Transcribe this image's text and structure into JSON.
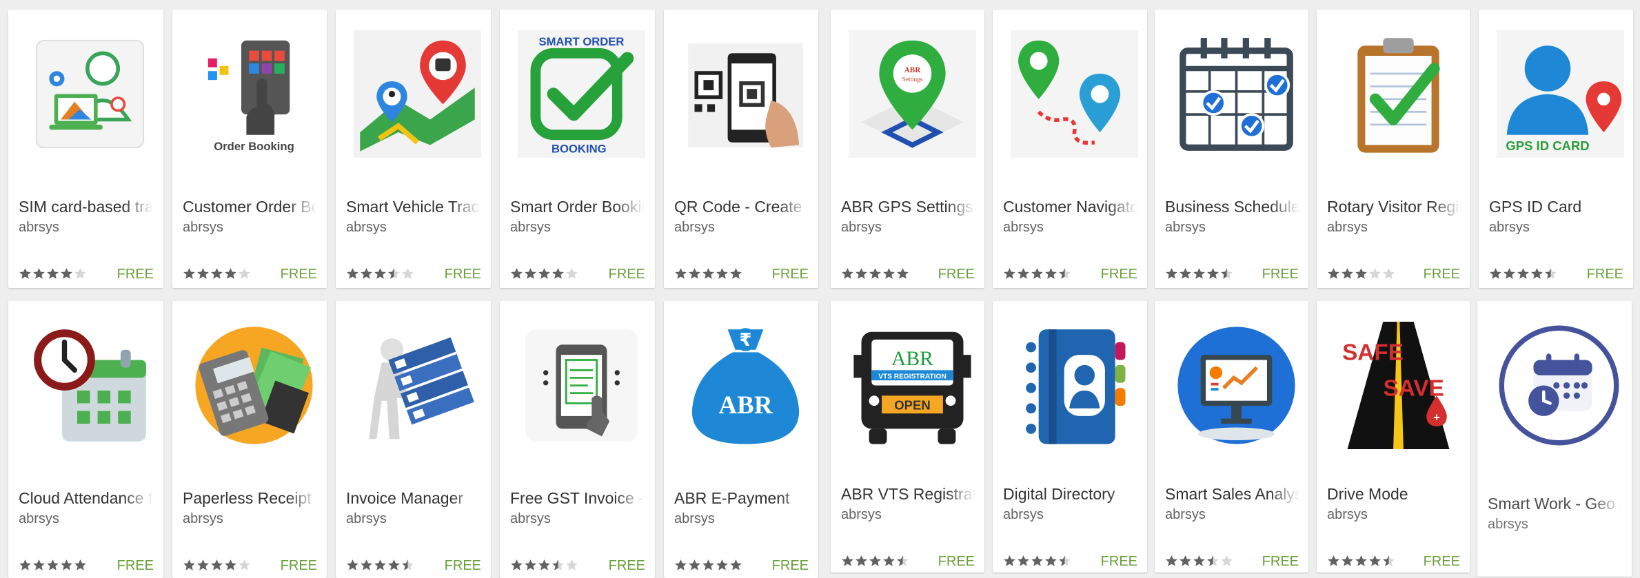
{
  "colors": {
    "free_label": "#689f38",
    "star_filled": "#616161",
    "star_empty": "#d6d6d6",
    "title_text": "#333333",
    "developer_text": "#616161"
  },
  "apps": [
    {
      "title": "SIM card-based tracking",
      "developer": "abrsys",
      "rating": 4.0,
      "price": "FREE",
      "icon": "sim-tracker-icon"
    },
    {
      "title": "Customer Order Booking",
      "developer": "abrsys",
      "rating": 4.0,
      "price": "FREE",
      "icon": "order-booking-icon"
    },
    {
      "title": "Smart Vehicle Tracking",
      "developer": "abrsys",
      "rating": 3.5,
      "price": "FREE",
      "icon": "vehicle-tracking-icon"
    },
    {
      "title": "Smart Order Booking",
      "developer": "abrsys",
      "rating": 4.0,
      "price": "FREE",
      "icon": "smart-order-booking-icon"
    },
    {
      "title": "QR Code - Create & Scan",
      "developer": "abrsys",
      "rating": 5.0,
      "price": "FREE",
      "icon": "qr-code-phone-icon"
    },
    {
      "title": "ABR GPS Settings",
      "developer": "abrsys",
      "rating": 5.0,
      "price": "FREE",
      "icon": "gps-settings-pin-icon"
    },
    {
      "title": "Customer Navigator",
      "developer": "abrsys",
      "rating": 4.5,
      "price": "FREE",
      "icon": "navigator-pins-icon"
    },
    {
      "title": "Business Scheduler",
      "developer": "abrsys",
      "rating": 4.5,
      "price": "FREE",
      "icon": "scheduler-calendar-icon"
    },
    {
      "title": "Rotary Visitor Register",
      "developer": "abrsys",
      "rating": 3.0,
      "price": "FREE",
      "icon": "clipboard-check-icon"
    },
    {
      "title": "GPS ID Card",
      "developer": "abrsys",
      "rating": 4.5,
      "price": "FREE",
      "icon": "gps-id-card-icon"
    },
    {
      "title": "Cloud Attendance for",
      "developer": "abrsys",
      "rating": 5.0,
      "price": "FREE",
      "icon": "attendance-clock-icon"
    },
    {
      "title": "Paperless Receipt",
      "developer": "abrsys",
      "rating": 4.0,
      "price": "FREE",
      "icon": "receipt-calculator-icon"
    },
    {
      "title": "Invoice Manager",
      "developer": "abrsys",
      "rating": 4.5,
      "price": "FREE",
      "icon": "invoice-files-icon"
    },
    {
      "title": "Free GST Invoice - D",
      "developer": "abrsys",
      "rating": 3.5,
      "price": "FREE",
      "icon": "gst-invoice-phone-icon"
    },
    {
      "title": "ABR E-Payment",
      "developer": "abrsys",
      "rating": 5.0,
      "price": "FREE",
      "icon": "rupee-money-bag-icon"
    },
    {
      "title": "ABR VTS Registration",
      "developer": "abrsys",
      "rating": 4.5,
      "price": "FREE",
      "icon": "vts-truck-icon"
    },
    {
      "title": "Digital Directory",
      "developer": "abrsys",
      "rating": 4.5,
      "price": "FREE",
      "icon": "contact-book-icon"
    },
    {
      "title": "Smart Sales Analysis",
      "developer": "abrsys",
      "rating": 3.5,
      "price": "FREE",
      "icon": "sales-monitor-icon"
    },
    {
      "title": "Drive Mode",
      "developer": "abrsys",
      "rating": 4.5,
      "price": "FREE",
      "icon": "safe-road-icon"
    },
    {
      "title": "Smart Work - Geo Z",
      "developer": "abrsys",
      "rating": null,
      "price": "",
      "icon": "geo-work-calendar-icon"
    }
  ]
}
